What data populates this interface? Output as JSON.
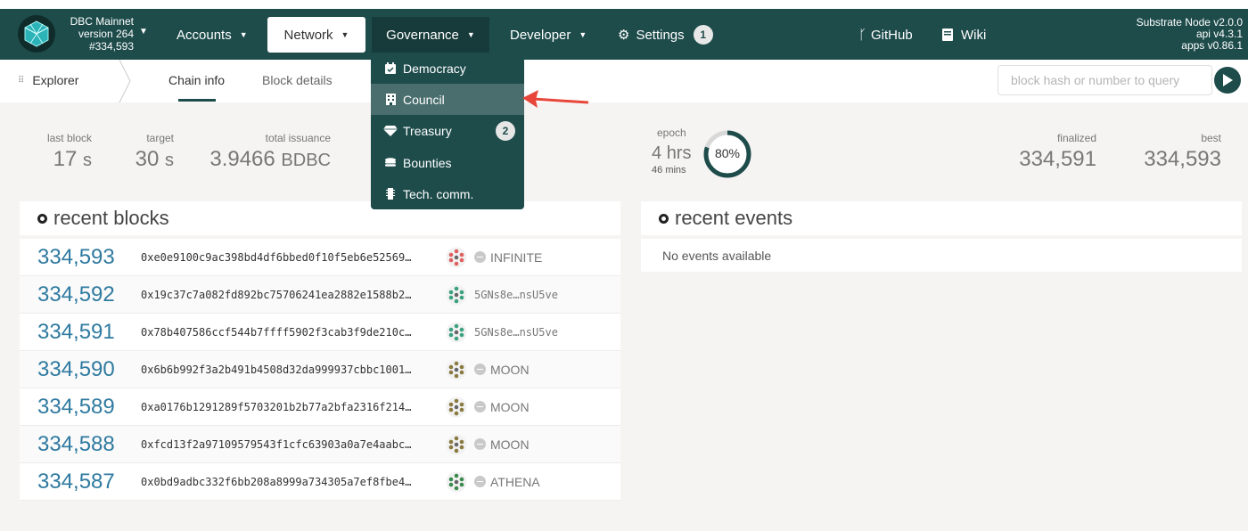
{
  "chain": {
    "name": "DBC Mainnet",
    "version": "version 264",
    "block": "#334,593"
  },
  "nav": {
    "accounts": "Accounts",
    "network": "Network",
    "governance": "Governance",
    "developer": "Developer",
    "settings": "Settings",
    "settings_badge": "1",
    "github": "GitHub",
    "wiki": "Wiki"
  },
  "node": {
    "line1": "Substrate Node v2.0.0",
    "line2": "api v4.3.1",
    "line3": "apps v0.86.1"
  },
  "governance_menu": [
    {
      "label": "Democracy",
      "icon": "calendar-check-icon"
    },
    {
      "label": "Council",
      "icon": "building-icon"
    },
    {
      "label": "Treasury",
      "icon": "gem-icon",
      "badge": "2"
    },
    {
      "label": "Bounties",
      "icon": "coins-icon"
    },
    {
      "label": "Tech. comm.",
      "icon": "microchip-icon"
    }
  ],
  "subnav": {
    "explorer": "Explorer",
    "chain_info": "Chain info",
    "block_details": "Block details",
    "query_placeholder": "block hash or number to query"
  },
  "stats": {
    "last_block": {
      "label": "last block",
      "value": "17",
      "unit": "s"
    },
    "target": {
      "label": "target",
      "value": "30",
      "unit": "s"
    },
    "total_issuance": {
      "label": "total issuance",
      "value": "3.9466",
      "unit": "BDBC"
    },
    "epoch": {
      "label": "epoch",
      "big": "4",
      "big_unit": "hrs",
      "small": "46",
      "small_unit": "mins",
      "progress_pct": 80,
      "progress_label": "80%"
    },
    "finalized": {
      "label": "finalized",
      "value": "334,591"
    },
    "best": {
      "label": "best",
      "value": "334,593"
    }
  },
  "recent_blocks": {
    "title": "recent blocks",
    "rows": [
      {
        "number": "334,593",
        "hash": "0xe0e9100c9ac398bd4df6bbed0f10f5eb6e52569…",
        "author": "INFINITE",
        "named": true,
        "ident_color": "#e06060"
      },
      {
        "number": "334,592",
        "hash": "0x19c37c7a082fd892bc75706241ea2882e1588b2…",
        "author": "5GNs8e…nsU5ve",
        "named": false,
        "ident_color": "#3aa080"
      },
      {
        "number": "334,591",
        "hash": "0x78b407586ccf544b7ffff5902f3cab3f9de210c…",
        "author": "5GNs8e…nsU5ve",
        "named": false,
        "ident_color": "#3aa080"
      },
      {
        "number": "334,590",
        "hash": "0x6b6b992f3a2b491b4508d32da999937cbbc1001…",
        "author": "MOON",
        "named": true,
        "ident_color": "#8a7a40"
      },
      {
        "number": "334,589",
        "hash": "0xa0176b1291289f5703201b2b77a2bfa2316f214…",
        "author": "MOON",
        "named": true,
        "ident_color": "#8a7a40"
      },
      {
        "number": "334,588",
        "hash": "0xfcd13f2a97109579543f1cfc63903a0a7e4aabc…",
        "author": "MOON",
        "named": true,
        "ident_color": "#8a7a40"
      },
      {
        "number": "334,587",
        "hash": "0x0bd9adbc332f6bb208a8999a734305a7ef8fbe4…",
        "author": "ATHENA",
        "named": true,
        "ident_color": "#3a8a50"
      }
    ]
  },
  "recent_events": {
    "title": "recent events",
    "empty": "No events available"
  },
  "colors": {
    "brand": "#1e4c4b",
    "link": "#2f7aa0",
    "highlight": "#4a6e6d",
    "annotation_arrow": "#e8463a"
  }
}
